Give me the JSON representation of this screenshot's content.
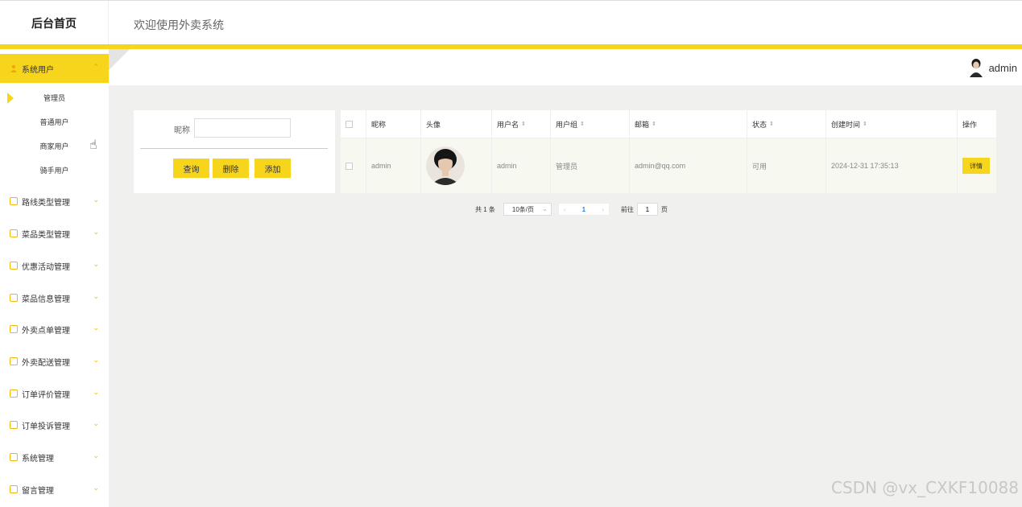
{
  "header": {
    "logo_text": "后台首页",
    "welcome_text": "欢迎使用外卖系统"
  },
  "user": {
    "name": "admin"
  },
  "sidebar": {
    "items": [
      {
        "label": "系统用户",
        "active": true,
        "expanded": true
      },
      {
        "label": "路线类型管理"
      },
      {
        "label": "菜品类型管理"
      },
      {
        "label": "优惠活动管理"
      },
      {
        "label": "菜品信息管理"
      },
      {
        "label": "外卖点单管理"
      },
      {
        "label": "外卖配送管理"
      },
      {
        "label": "订单评价管理"
      },
      {
        "label": "订单投诉管理"
      },
      {
        "label": "系统管理"
      },
      {
        "label": "留言管理"
      }
    ],
    "sub_items": [
      {
        "label": "管理员",
        "active": true
      },
      {
        "label": "普通用户"
      },
      {
        "label": "商家用户"
      },
      {
        "label": "骑手用户"
      }
    ]
  },
  "search": {
    "label": "昵称",
    "value": "",
    "query_label": "查询",
    "delete_label": "删除",
    "add_label": "添加"
  },
  "table": {
    "columns": [
      "昵称",
      "头像",
      "用户名",
      "用户组",
      "邮箱",
      "状态",
      "创建时间",
      "操作"
    ],
    "rows": [
      {
        "nickname": "admin",
        "username": "admin",
        "group": "管理员",
        "email": "admin@qq.com",
        "status": "可用",
        "created": "2024-12-31 17:35:13",
        "action": "详情"
      }
    ]
  },
  "pagination": {
    "total_text": "共 1 条",
    "page_size": "10条/页",
    "current_page": "1",
    "goto_prefix": "前往",
    "goto_value": "1",
    "goto_suffix": "页"
  },
  "watermark": "CSDN @vx_CXKF10088",
  "colors": {
    "accent": "#f7d51d",
    "icon": "#f2b705",
    "background": "#f0f0ef"
  }
}
